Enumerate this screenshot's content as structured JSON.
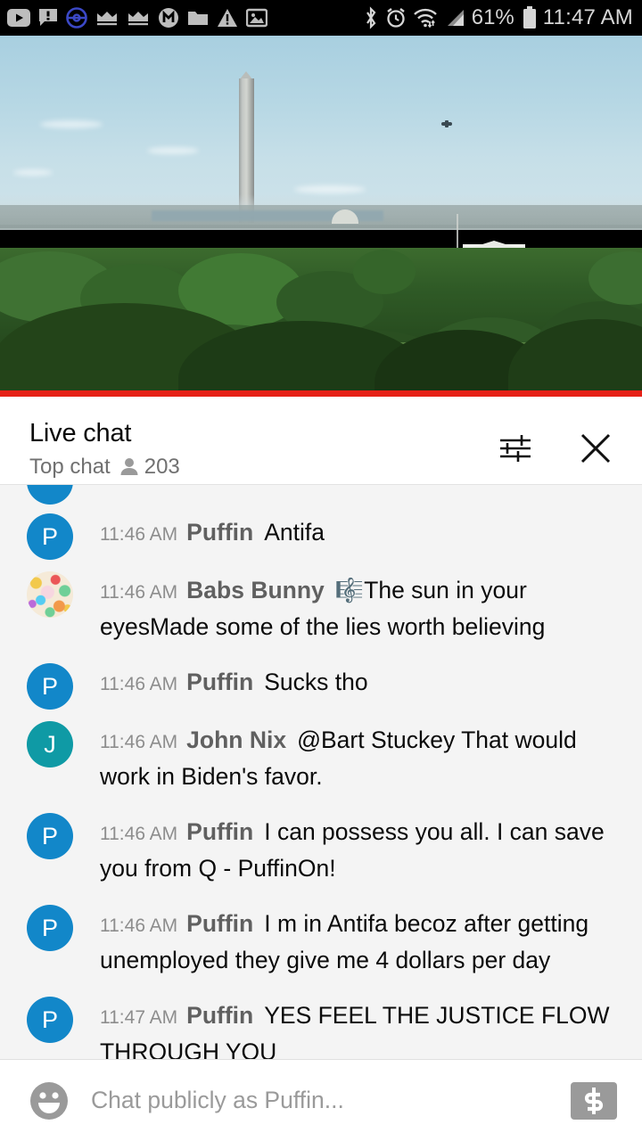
{
  "status_bar": {
    "icons_left": [
      {
        "name": "youtube-icon",
        "label": "YouTube"
      },
      {
        "name": "message-alert-icon",
        "label": "Message alert"
      },
      {
        "name": "pokeball-icon",
        "label": "Pokemon Go"
      },
      {
        "name": "crown-icon-1",
        "label": "Crown"
      },
      {
        "name": "crown-icon-2",
        "label": "Crown"
      },
      {
        "name": "m-circle-icon",
        "label": "M"
      },
      {
        "name": "folder-icon",
        "label": "Folder"
      },
      {
        "name": "warning-triangle-icon",
        "label": "Warning"
      },
      {
        "name": "image-icon",
        "label": "Image"
      }
    ],
    "icons_right": [
      {
        "name": "bluetooth-icon",
        "label": "Bluetooth"
      },
      {
        "name": "alarm-clock-icon",
        "label": "Alarm"
      },
      {
        "name": "wifi-icon",
        "label": "Wi-Fi"
      },
      {
        "name": "cell-signal-icon",
        "label": "Signal"
      }
    ],
    "battery_percent": "61%",
    "clock": "11:47 AM"
  },
  "video": {
    "accent_color": "#e62117",
    "progress_percent": 100,
    "scene_description": "Washington DC skyline with Washington Monument and the White House"
  },
  "chat_header": {
    "title": "Live chat",
    "mode": "Top chat",
    "viewer_count": "203",
    "viewers_icon": "person-icon",
    "settings_icon": "tune-sliders-icon",
    "close_icon": "close-x-icon"
  },
  "messages": [
    {
      "time": "11:46 AM",
      "author": "Puffin",
      "text": "Antifa",
      "avatar_letter": "P",
      "avatar_color": "#1287c9",
      "avatar_type": "letter"
    },
    {
      "time": "11:46 AM",
      "author": "Babs Bunny",
      "emoji": "🎼",
      "text": "The sun in your eyesMade some of the lies worth believing",
      "avatar_letter": "",
      "avatar_color": "#f5ead8",
      "avatar_type": "image"
    },
    {
      "time": "11:46 AM",
      "author": "Puffin",
      "text": "Sucks tho",
      "avatar_letter": "P",
      "avatar_color": "#1287c9",
      "avatar_type": "letter"
    },
    {
      "time": "11:46 AM",
      "author": "John Nix",
      "text": "@Bart Stuckey That would work in Biden's favor.",
      "avatar_letter": "J",
      "avatar_color": "#0f9aa5",
      "avatar_type": "letter"
    },
    {
      "time": "11:46 AM",
      "author": "Puffin",
      "text": "I can possess you all. I can save you from Q - PuffinOn!",
      "avatar_letter": "P",
      "avatar_color": "#1287c9",
      "avatar_type": "letter"
    },
    {
      "time": "11:46 AM",
      "author": "Puffin",
      "text": "I m in Antifa becoz after getting unemployed they give me 4 dollars per day",
      "avatar_letter": "P",
      "avatar_color": "#1287c9",
      "avatar_type": "letter"
    },
    {
      "time": "11:47 AM",
      "author": "Puffin",
      "text": "YES FEEL THE JUSTICE FLOW THROUGH YOU",
      "avatar_letter": "P",
      "avatar_color": "#1287c9",
      "avatar_type": "letter"
    }
  ],
  "chat_input": {
    "placeholder": "Chat publicly as Puffin...",
    "value": "",
    "emoji_icon": "smiley-face-icon",
    "superchat_icon": "dollar-superchat-icon"
  }
}
